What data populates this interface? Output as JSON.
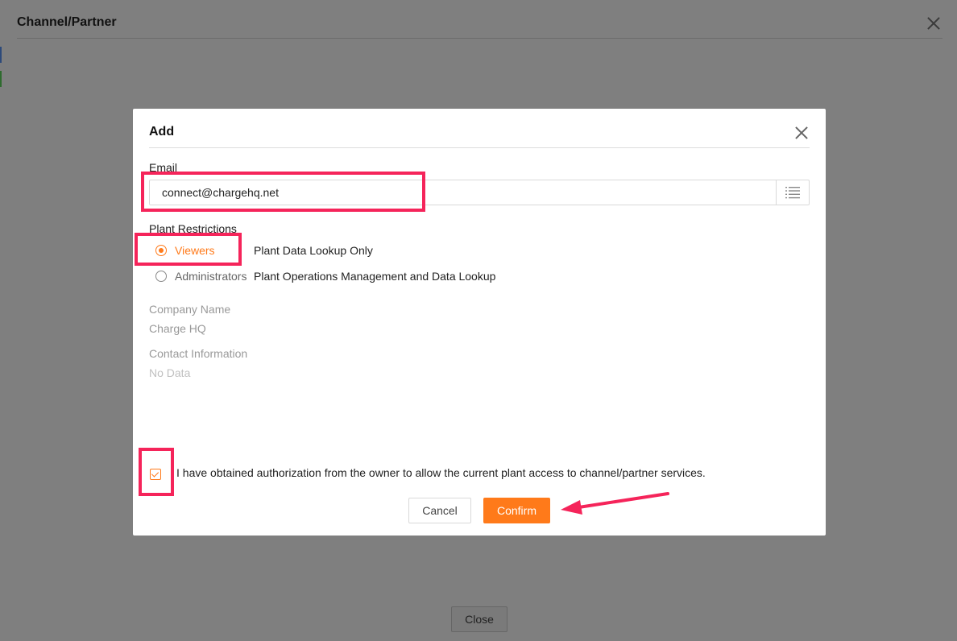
{
  "outer": {
    "title": "Channel/Partner",
    "close_button": "Close"
  },
  "modal": {
    "title": "Add",
    "email": {
      "label": "Email",
      "value": "connect@chargehq.net"
    },
    "plant_restrictions": {
      "label": "Plant Restrictions",
      "options": [
        {
          "label": "Viewers",
          "description": "Plant Data Lookup Only",
          "selected": true
        },
        {
          "label": "Administrators",
          "description": "Plant Operations Management and Data Lookup",
          "selected": false
        }
      ]
    },
    "company_name": {
      "label": "Company Name",
      "value": "Charge HQ"
    },
    "contact_information": {
      "label": "Contact Information",
      "value": "No Data"
    },
    "authorization": {
      "checked": true,
      "text": "I have obtained authorization from the owner to allow the current plant access to channel/partner services."
    },
    "buttons": {
      "cancel": "Cancel",
      "confirm": "Confirm"
    }
  },
  "colors": {
    "accent": "#ff7a1a",
    "annotation": "#f5245a",
    "overlay": "#808080"
  },
  "icons": {
    "list_button": "list-icon",
    "close": "close-icon",
    "check": "check-icon"
  }
}
